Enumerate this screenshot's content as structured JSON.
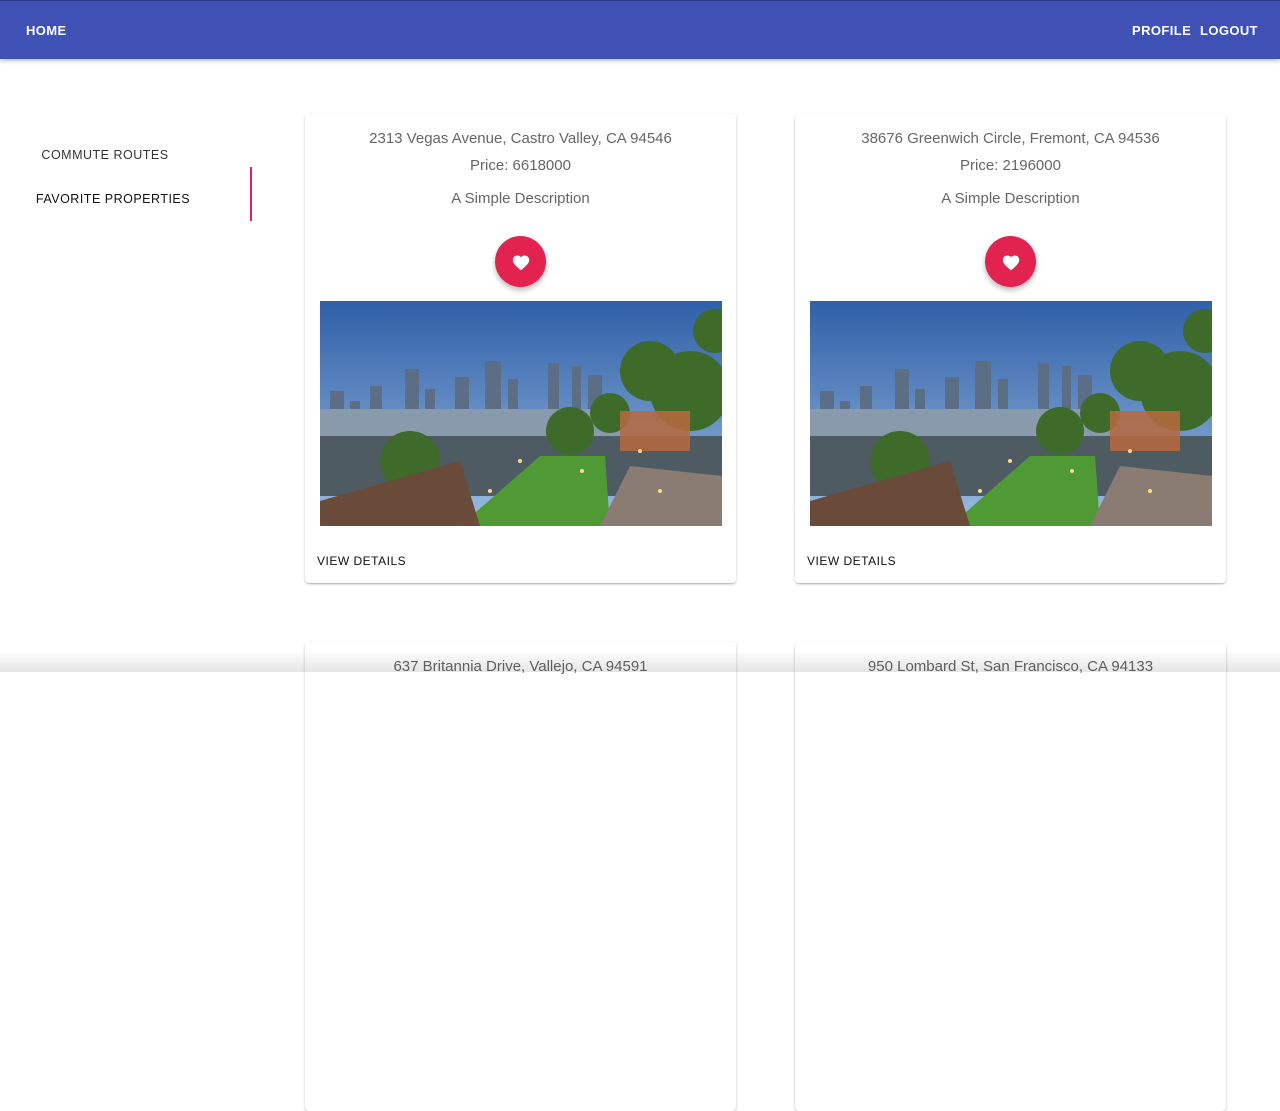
{
  "header": {
    "home_label": "HOME",
    "profile_label": "PROFILE",
    "logout_label": "LOGOUT",
    "color": "#3f51b5"
  },
  "sidebar": {
    "tabs": [
      {
        "label": "COMMUTE ROUTES",
        "selected": false
      },
      {
        "label": "FAVORITE PROPERTIES",
        "selected": true
      }
    ],
    "indicator_color": "#e91e63"
  },
  "properties": [
    {
      "address": "2313 Vegas Avenue, Castro Valley, CA 94546",
      "price": "Price: 6618000",
      "description": "A Simple Description",
      "favorite_icon": "heart-icon",
      "view_label": "VIEW DETAILS"
    },
    {
      "address": "38676 Greenwich Circle, Fremont, CA 94536",
      "price": "Price: 2196000",
      "description": "A Simple Description",
      "favorite_icon": "heart-icon",
      "view_label": "VIEW DETAILS"
    },
    {
      "address": "637 Britannia Drive, Vallejo, CA 94591"
    },
    {
      "address": "950 Lombard St, San Francisco, CA 94133"
    }
  ],
  "fab_color": "#e2234f"
}
